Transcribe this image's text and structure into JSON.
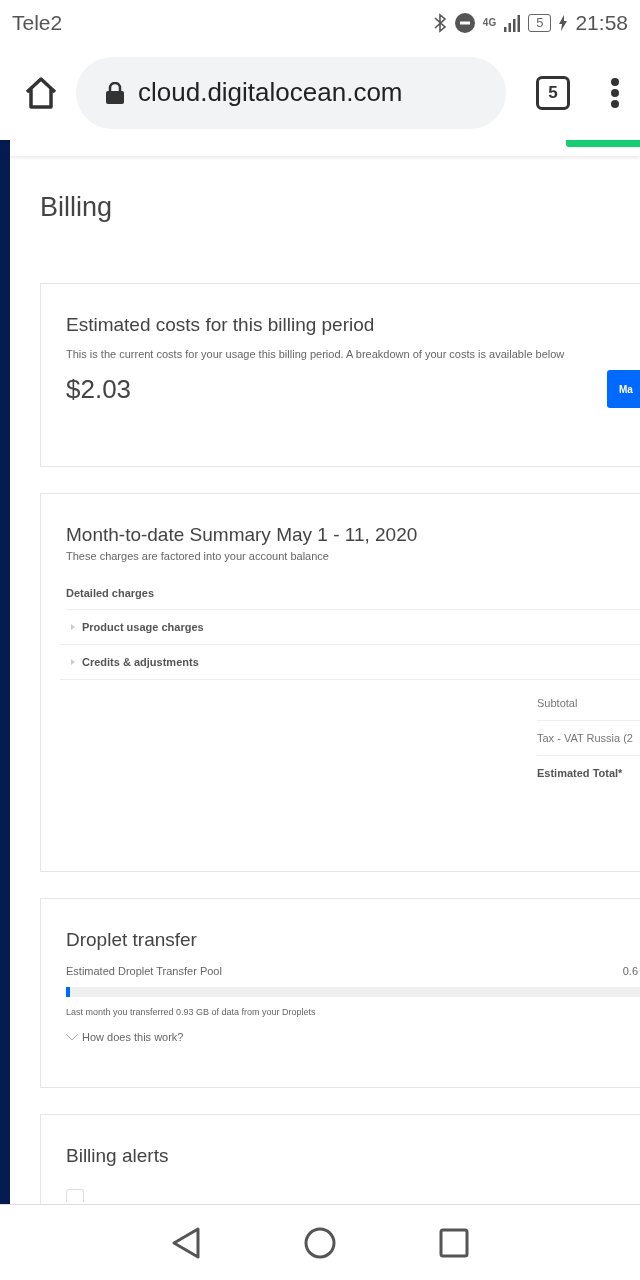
{
  "status_bar": {
    "carrier": "Tele2",
    "network": "4G",
    "battery": "5",
    "time": "21:58"
  },
  "browser": {
    "url": "cloud.digitalocean.com",
    "tab_count": "5"
  },
  "page": {
    "title": "Billing"
  },
  "estimated": {
    "title": "Estimated costs for this billing period",
    "description": "This is the current costs for your usage this billing period. A breakdown of your costs is available below",
    "amount": "$2.03",
    "button": "Ma"
  },
  "summary": {
    "title": "Month-to-date Summary May 1 - 11, 2020",
    "subtitle": "These charges are factored into your account balance",
    "section": "Detailed charges",
    "rows": [
      {
        "label": "Product usage charges",
        "expanded": false
      },
      {
        "label": "Credits & adjustments",
        "expanded": false
      }
    ],
    "totals": [
      {
        "label": "Subtotal",
        "kind": "normal"
      },
      {
        "label": "Tax - VAT Russia (2",
        "kind": "normal"
      },
      {
        "label": "Estimated Total*",
        "kind": "bold"
      }
    ]
  },
  "transfer": {
    "title": "Droplet transfer",
    "label": "Estimated Droplet Transfer Pool",
    "value": "0.6",
    "level": 0.006,
    "note": "Last month you transferred 0.93 GB of data from your Droplets",
    "help": "How does this work?"
  },
  "alerts": {
    "title": "Billing alerts",
    "checked": false
  }
}
